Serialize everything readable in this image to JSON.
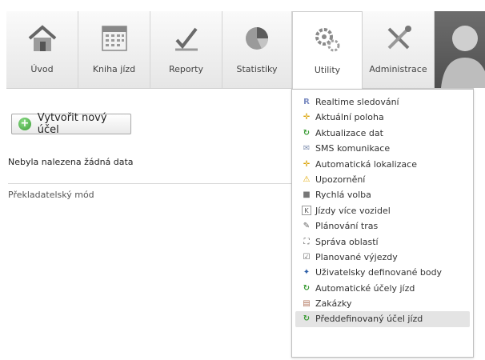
{
  "nav": {
    "tabs": [
      {
        "label": "Úvod",
        "icon": "house-icon"
      },
      {
        "label": "Kniha jízd",
        "icon": "calendar-icon"
      },
      {
        "label": "Reporty",
        "icon": "pencil-check-icon"
      },
      {
        "label": "Statistiky",
        "icon": "pie-chart-icon"
      },
      {
        "label": "Utility",
        "icon": "gears-icon",
        "active": true
      },
      {
        "label": "Administrace",
        "icon": "tools-icon"
      }
    ],
    "avatar": "user-avatar-icon"
  },
  "main": {
    "create_button": "Vytvořit nový účel",
    "empty_message": "Nebyla nalezena žádná data",
    "footer_link": "Překladatelský mód"
  },
  "menu": {
    "items": [
      {
        "label": "Realtime sledování",
        "icon": "realtime-icon"
      },
      {
        "label": "Aktuální poloha",
        "icon": "location-icon"
      },
      {
        "label": "Aktualizace dat",
        "icon": "refresh-icon"
      },
      {
        "label": "SMS komunikace",
        "icon": "envelope-icon"
      },
      {
        "label": "Automatická lokalizace",
        "icon": "location-icon"
      },
      {
        "label": "Upozornění",
        "icon": "warning-icon"
      },
      {
        "label": "Rychlá volba",
        "icon": "square-icon"
      },
      {
        "label": "Jízdy více vozidel",
        "icon": "multi-vehicle-icon"
      },
      {
        "label": "Plánování tras",
        "icon": "route-icon"
      },
      {
        "label": "Správa oblastí",
        "icon": "area-icon"
      },
      {
        "label": "Planované výjezdy",
        "icon": "checkbox-icon"
      },
      {
        "label": "Uživatelsky definované body",
        "icon": "pin-icon"
      },
      {
        "label": "Automatické účely jízd",
        "icon": "refresh-icon"
      },
      {
        "label": "Zakázky",
        "icon": "document-icon"
      },
      {
        "label": "Předdefinovaný účel jízd",
        "icon": "refresh-icon",
        "highlighted": true
      }
    ]
  },
  "colors": {
    "accent_green": "#3a9b35",
    "menu_highlight": "#e4e4e4"
  }
}
